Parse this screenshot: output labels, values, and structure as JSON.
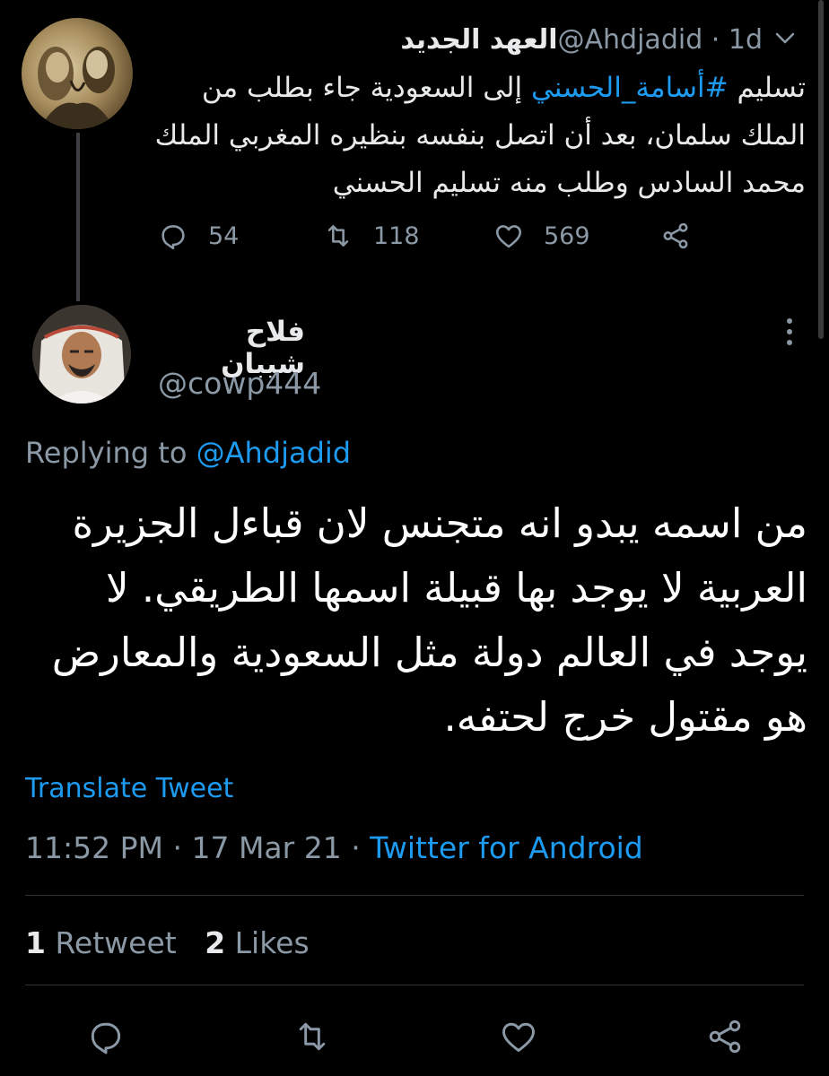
{
  "parent_tweet": {
    "display_name": "العهد الجديد",
    "handle": "@Ahdjadid",
    "time": "1d",
    "text_before": "تسليم ",
    "hashtag": "#أسامة_الحسني",
    "text_after": " إلى السعودية جاء بطلب من الملك سلمان، بعد أن اتصل بنفسه بنظيره المغربي الملك محمد السادس وطلب منه تسليم الحسني",
    "reply_count": "54",
    "retweet_count": "118",
    "like_count": "569"
  },
  "main_tweet": {
    "display_name": "فلاح شيبان",
    "handle": "@cowp444",
    "replying_prefix": "Replying to ",
    "replying_to": "@Ahdjadid",
    "text": "من اسمه يبدو انه متجنس لان قباءل الجزيرة العربية لا يوجد بها قبيلة اسمها الطريقي.  لا يوجد في العالم دولة مثل السعودية والمعارض هو مقتول خرج لحتفه.",
    "translate_label": "Translate Tweet",
    "time": "11:52 PM",
    "separator": "·",
    "date": "17 Mar 21",
    "source": "Twitter for Android",
    "retweets_count": "1",
    "retweets_label": "Retweet",
    "likes_count": "2",
    "likes_label": "Likes"
  },
  "colors": {
    "background": "#000000",
    "text": "#e7e9ea",
    "muted": "#8b98a5",
    "accent": "#1d9bf0",
    "divider": "#2f3336"
  },
  "icons": [
    "chevron-down-icon",
    "reply-icon",
    "retweet-icon",
    "like-icon",
    "share-icon",
    "more-dots-icon"
  ]
}
